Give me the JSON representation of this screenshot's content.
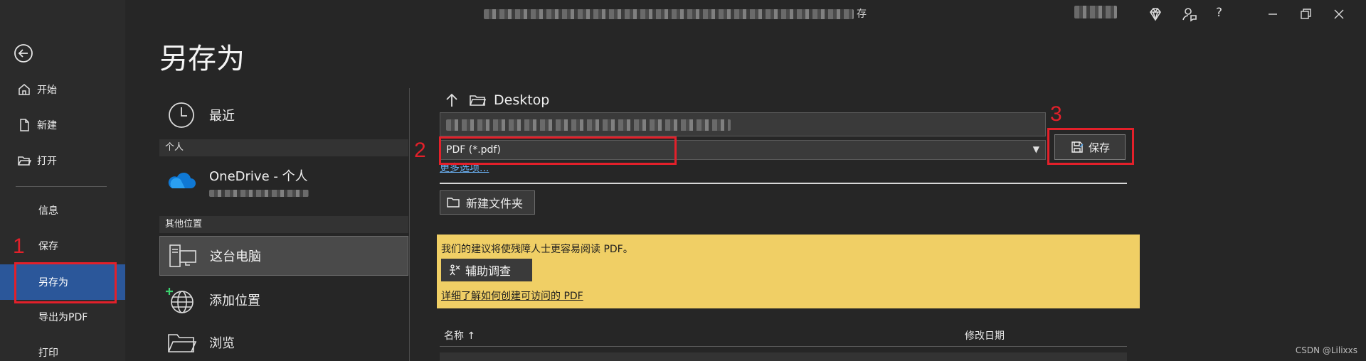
{
  "window": {
    "title_suffix": "存",
    "help_label": "?"
  },
  "nav": {
    "items": [
      {
        "label": "开始",
        "icon": "home-icon"
      },
      {
        "label": "新建",
        "icon": "new-document-icon"
      },
      {
        "label": "打开",
        "icon": "open-folder-icon"
      },
      {
        "label": "信息"
      },
      {
        "label": "保存"
      },
      {
        "label": "另存为"
      },
      {
        "label": "导出为PDF"
      },
      {
        "label": "打印"
      }
    ]
  },
  "page": {
    "title": "另存为"
  },
  "locations": {
    "recent": "最近",
    "personal_header": "个人",
    "onedrive": "OneDrive - 个人",
    "other_header": "其他位置",
    "this_pc": "这台电脑",
    "add_place": "添加位置",
    "browse": "浏览"
  },
  "save_panel": {
    "path": "Desktop",
    "file_type": "PDF (*.pdf)",
    "more_options": "更多选项...",
    "save_button": "保存",
    "new_folder": "新建文件夹",
    "accessibility_message": "我们的建议将使残障人士更容易阅读 PDF。",
    "accessibility_button": "辅助调查",
    "accessibility_link": "详细了解如何创建可访问的 PDF",
    "col_name": "名称 ↑",
    "col_date": "修改日期"
  },
  "annotations": [
    "1",
    "2",
    "3"
  ],
  "watermark": "CSDN @Lilixxs",
  "colors": {
    "active_nav": "#2b579a",
    "banner": "#f0cf65",
    "annotation": "#e3202a",
    "link": "#6ab0f3"
  }
}
